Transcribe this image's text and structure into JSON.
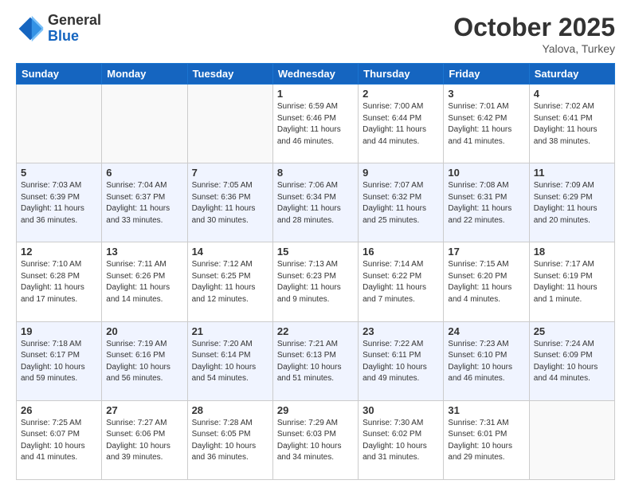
{
  "header": {
    "logo_line1": "General",
    "logo_line2": "Blue",
    "title": "October 2025",
    "location": "Yalova, Turkey"
  },
  "days_of_week": [
    "Sunday",
    "Monday",
    "Tuesday",
    "Wednesday",
    "Thursday",
    "Friday",
    "Saturday"
  ],
  "weeks": [
    [
      {
        "day": "",
        "info": ""
      },
      {
        "day": "",
        "info": ""
      },
      {
        "day": "",
        "info": ""
      },
      {
        "day": "1",
        "info": "Sunrise: 6:59 AM\nSunset: 6:46 PM\nDaylight: 11 hours\nand 46 minutes."
      },
      {
        "day": "2",
        "info": "Sunrise: 7:00 AM\nSunset: 6:44 PM\nDaylight: 11 hours\nand 44 minutes."
      },
      {
        "day": "3",
        "info": "Sunrise: 7:01 AM\nSunset: 6:42 PM\nDaylight: 11 hours\nand 41 minutes."
      },
      {
        "day": "4",
        "info": "Sunrise: 7:02 AM\nSunset: 6:41 PM\nDaylight: 11 hours\nand 38 minutes."
      }
    ],
    [
      {
        "day": "5",
        "info": "Sunrise: 7:03 AM\nSunset: 6:39 PM\nDaylight: 11 hours\nand 36 minutes."
      },
      {
        "day": "6",
        "info": "Sunrise: 7:04 AM\nSunset: 6:37 PM\nDaylight: 11 hours\nand 33 minutes."
      },
      {
        "day": "7",
        "info": "Sunrise: 7:05 AM\nSunset: 6:36 PM\nDaylight: 11 hours\nand 30 minutes."
      },
      {
        "day": "8",
        "info": "Sunrise: 7:06 AM\nSunset: 6:34 PM\nDaylight: 11 hours\nand 28 minutes."
      },
      {
        "day": "9",
        "info": "Sunrise: 7:07 AM\nSunset: 6:32 PM\nDaylight: 11 hours\nand 25 minutes."
      },
      {
        "day": "10",
        "info": "Sunrise: 7:08 AM\nSunset: 6:31 PM\nDaylight: 11 hours\nand 22 minutes."
      },
      {
        "day": "11",
        "info": "Sunrise: 7:09 AM\nSunset: 6:29 PM\nDaylight: 11 hours\nand 20 minutes."
      }
    ],
    [
      {
        "day": "12",
        "info": "Sunrise: 7:10 AM\nSunset: 6:28 PM\nDaylight: 11 hours\nand 17 minutes."
      },
      {
        "day": "13",
        "info": "Sunrise: 7:11 AM\nSunset: 6:26 PM\nDaylight: 11 hours\nand 14 minutes."
      },
      {
        "day": "14",
        "info": "Sunrise: 7:12 AM\nSunset: 6:25 PM\nDaylight: 11 hours\nand 12 minutes."
      },
      {
        "day": "15",
        "info": "Sunrise: 7:13 AM\nSunset: 6:23 PM\nDaylight: 11 hours\nand 9 minutes."
      },
      {
        "day": "16",
        "info": "Sunrise: 7:14 AM\nSunset: 6:22 PM\nDaylight: 11 hours\nand 7 minutes."
      },
      {
        "day": "17",
        "info": "Sunrise: 7:15 AM\nSunset: 6:20 PM\nDaylight: 11 hours\nand 4 minutes."
      },
      {
        "day": "18",
        "info": "Sunrise: 7:17 AM\nSunset: 6:19 PM\nDaylight: 11 hours\nand 1 minute."
      }
    ],
    [
      {
        "day": "19",
        "info": "Sunrise: 7:18 AM\nSunset: 6:17 PM\nDaylight: 10 hours\nand 59 minutes."
      },
      {
        "day": "20",
        "info": "Sunrise: 7:19 AM\nSunset: 6:16 PM\nDaylight: 10 hours\nand 56 minutes."
      },
      {
        "day": "21",
        "info": "Sunrise: 7:20 AM\nSunset: 6:14 PM\nDaylight: 10 hours\nand 54 minutes."
      },
      {
        "day": "22",
        "info": "Sunrise: 7:21 AM\nSunset: 6:13 PM\nDaylight: 10 hours\nand 51 minutes."
      },
      {
        "day": "23",
        "info": "Sunrise: 7:22 AM\nSunset: 6:11 PM\nDaylight: 10 hours\nand 49 minutes."
      },
      {
        "day": "24",
        "info": "Sunrise: 7:23 AM\nSunset: 6:10 PM\nDaylight: 10 hours\nand 46 minutes."
      },
      {
        "day": "25",
        "info": "Sunrise: 7:24 AM\nSunset: 6:09 PM\nDaylight: 10 hours\nand 44 minutes."
      }
    ],
    [
      {
        "day": "26",
        "info": "Sunrise: 7:25 AM\nSunset: 6:07 PM\nDaylight: 10 hours\nand 41 minutes."
      },
      {
        "day": "27",
        "info": "Sunrise: 7:27 AM\nSunset: 6:06 PM\nDaylight: 10 hours\nand 39 minutes."
      },
      {
        "day": "28",
        "info": "Sunrise: 7:28 AM\nSunset: 6:05 PM\nDaylight: 10 hours\nand 36 minutes."
      },
      {
        "day": "29",
        "info": "Sunrise: 7:29 AM\nSunset: 6:03 PM\nDaylight: 10 hours\nand 34 minutes."
      },
      {
        "day": "30",
        "info": "Sunrise: 7:30 AM\nSunset: 6:02 PM\nDaylight: 10 hours\nand 31 minutes."
      },
      {
        "day": "31",
        "info": "Sunrise: 7:31 AM\nSunset: 6:01 PM\nDaylight: 10 hours\nand 29 minutes."
      },
      {
        "day": "",
        "info": ""
      }
    ]
  ]
}
